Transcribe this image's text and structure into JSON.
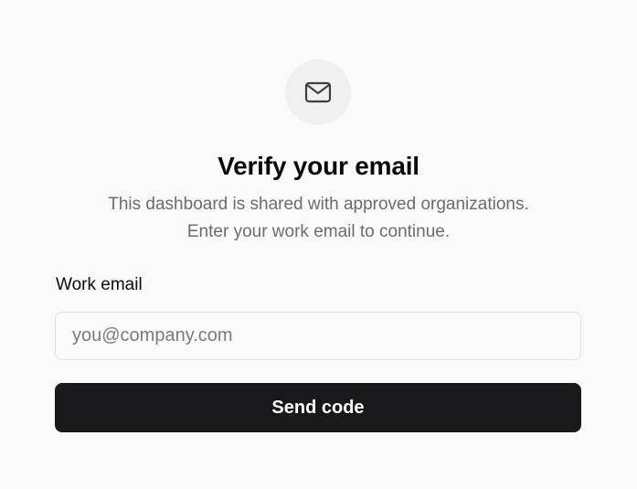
{
  "header": {
    "icon": "mail-icon",
    "title": "Verify your email",
    "subtitle_line1": "This dashboard is shared with approved organizations.",
    "subtitle_line2": "Enter your work email to continue."
  },
  "form": {
    "email_label": "Work email",
    "email_placeholder": "you@company.com",
    "email_value": "",
    "submit_label": "Send code"
  },
  "colors": {
    "background": "#fafafa",
    "button_bg": "#19191b",
    "button_text": "#ffffff",
    "muted_text": "#6b6b72",
    "icon_circle_bg": "#f0f0f1"
  }
}
